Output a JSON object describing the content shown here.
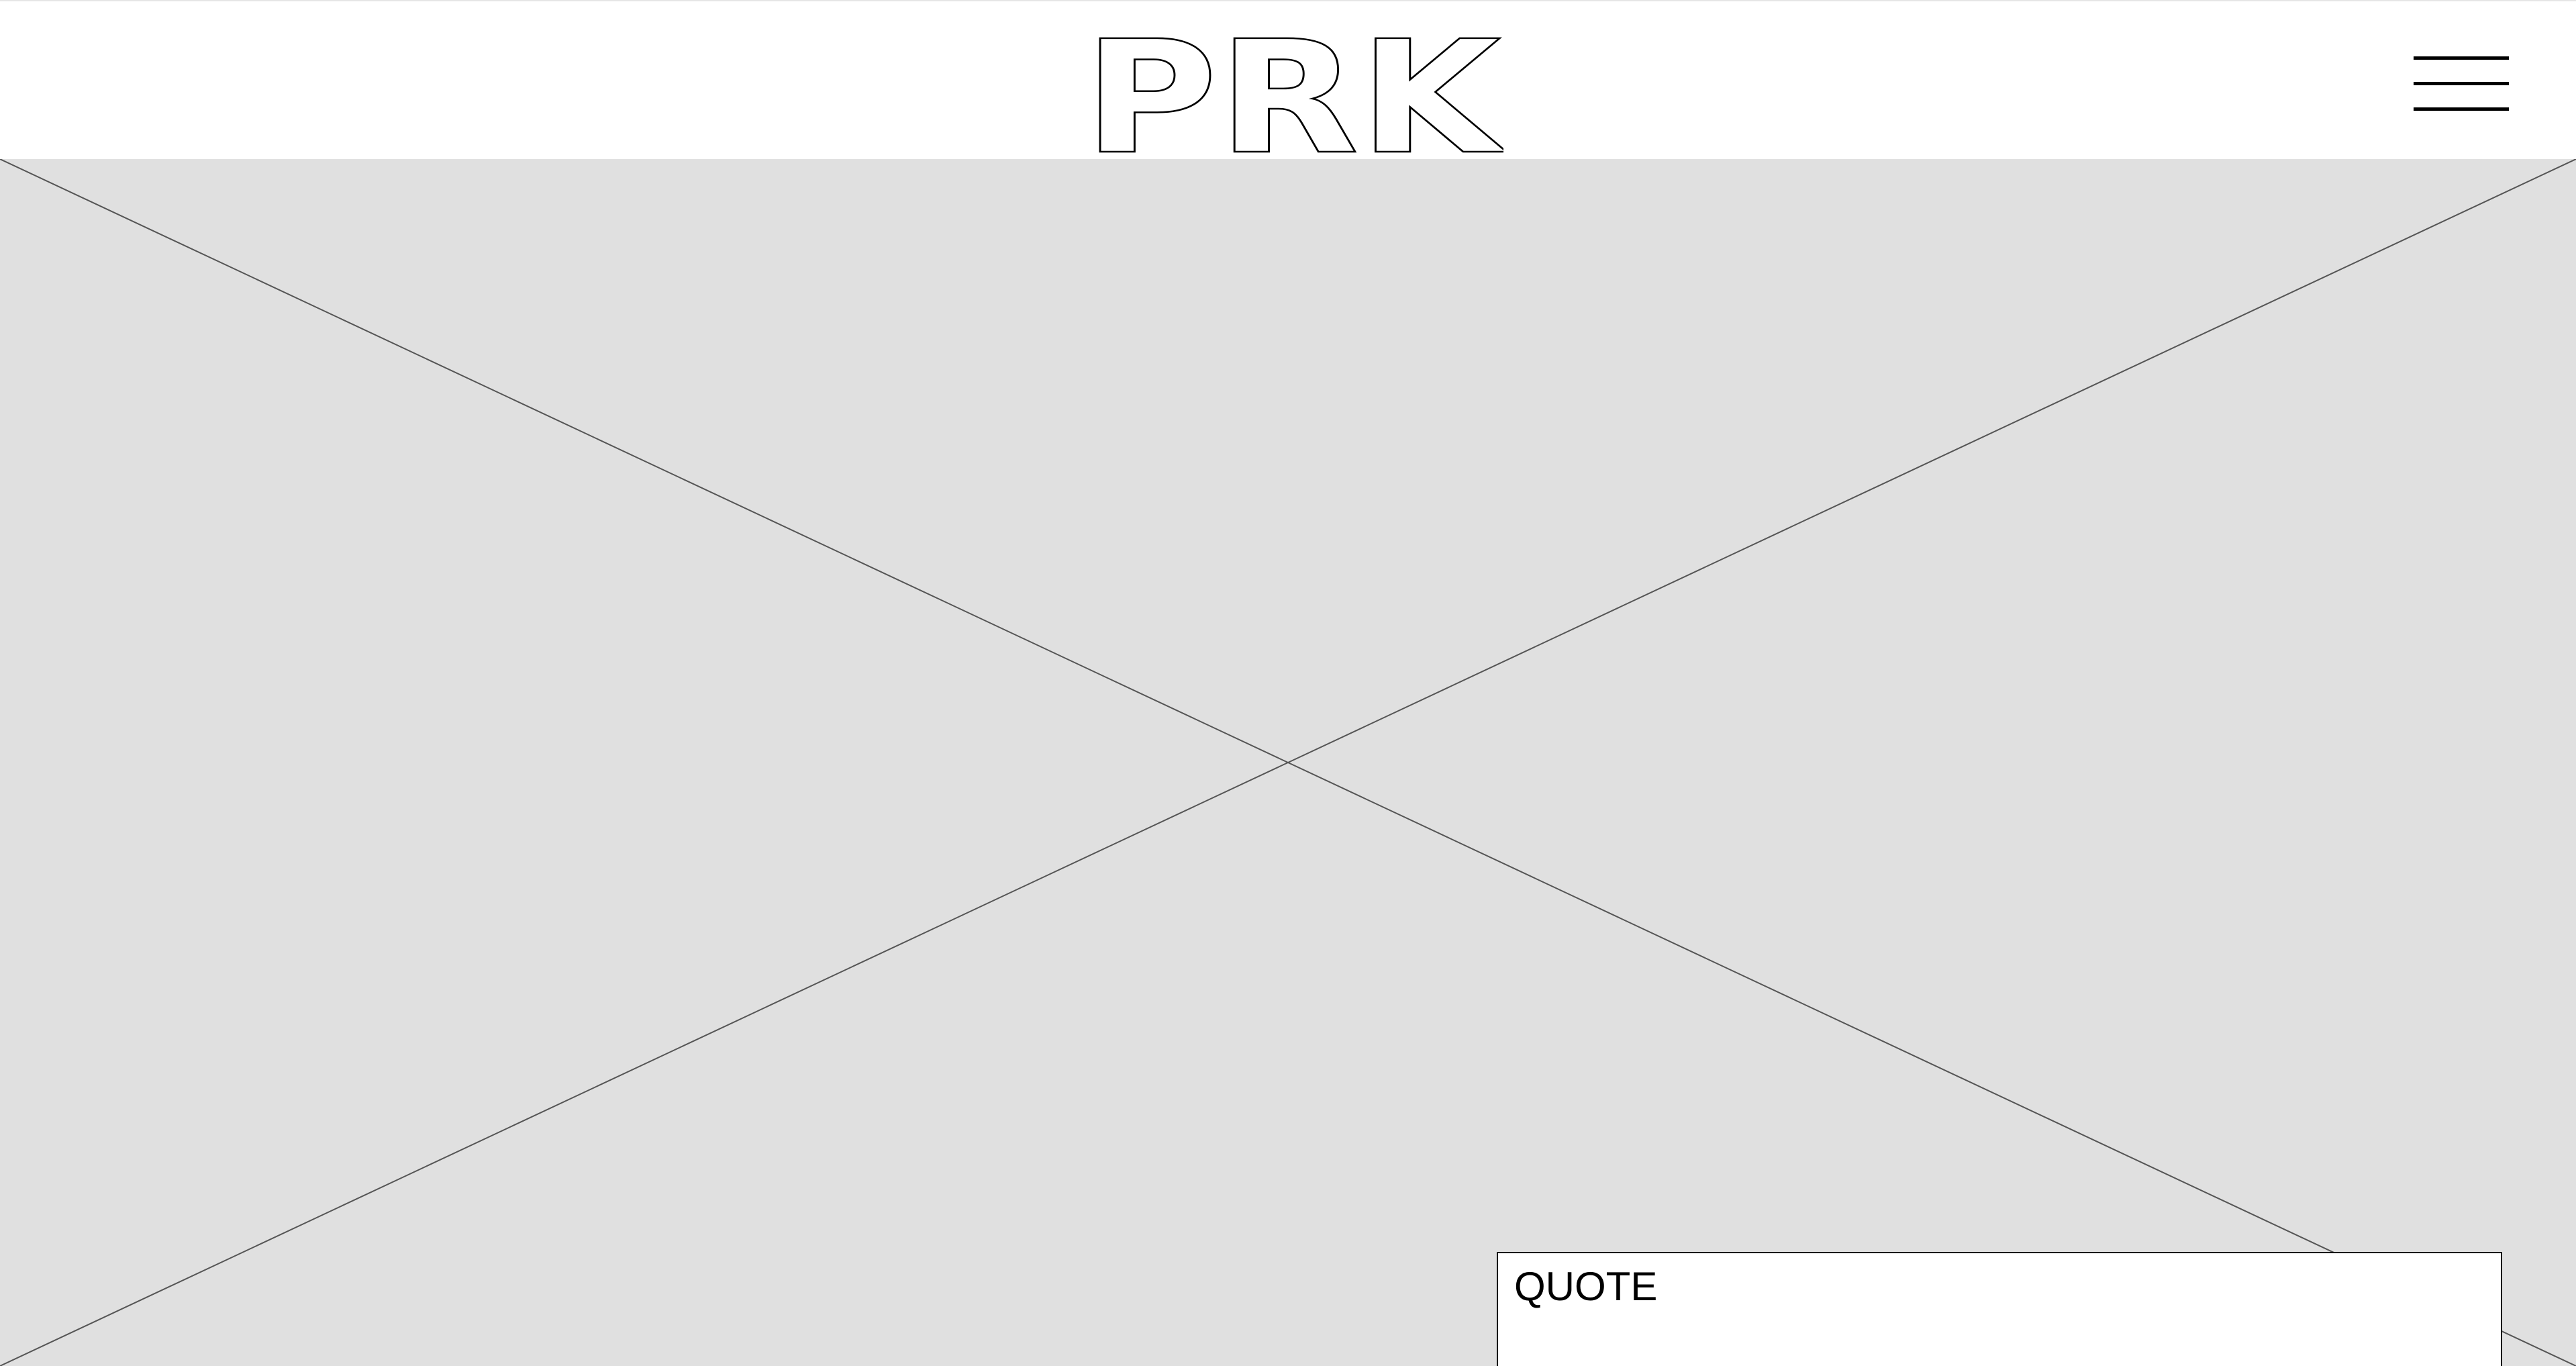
{
  "header": {
    "logo_text": "PRK",
    "menu_icon": "hamburger-menu-icon"
  },
  "hero": {
    "placeholder_icon": "image-placeholder-cross-icon",
    "background_color": "#e0e0e0"
  },
  "quote": {
    "label": "QUOTE"
  }
}
